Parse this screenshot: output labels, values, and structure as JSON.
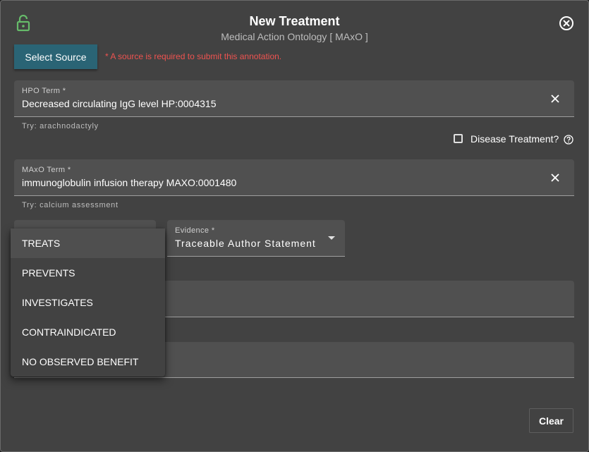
{
  "dialog": {
    "title": "New Treatment",
    "subtitle": "Medical Action Ontology [ MAxO ]"
  },
  "source": {
    "button_label": "Select Source",
    "warning": "* A source is required to submit this annotation."
  },
  "hpo_term": {
    "label": "HPO Term *",
    "value": "Decreased circulating IgG level HP:0004315",
    "helper": "Try: arachnodactyly"
  },
  "disease_treatment": {
    "label": "Disease Treatment?",
    "checked": false
  },
  "maxo_term": {
    "label": "MAxO Term *",
    "value": "immunoglobulin infusion therapy MAXO:0001480",
    "helper": "Try: calcium assessment"
  },
  "evidence": {
    "label": "Evidence *",
    "value": "Traceable Author Statement"
  },
  "relation_menu": {
    "items": [
      "TREATS",
      "PREVENTS",
      "INVESTIGATES",
      "CONTRAINDICATED",
      "NO OBSERVED BENEFIT"
    ],
    "selected": "TREATS"
  },
  "actions": {
    "clear_label": "Clear"
  },
  "colors": {
    "accent": "#2a6475",
    "warning": "#ef5350",
    "lock": "#66bb6a"
  },
  "icons": [
    "lock-open-icon",
    "close-circle-icon",
    "clear-icon",
    "help-circle-icon",
    "caret-down-icon"
  ]
}
